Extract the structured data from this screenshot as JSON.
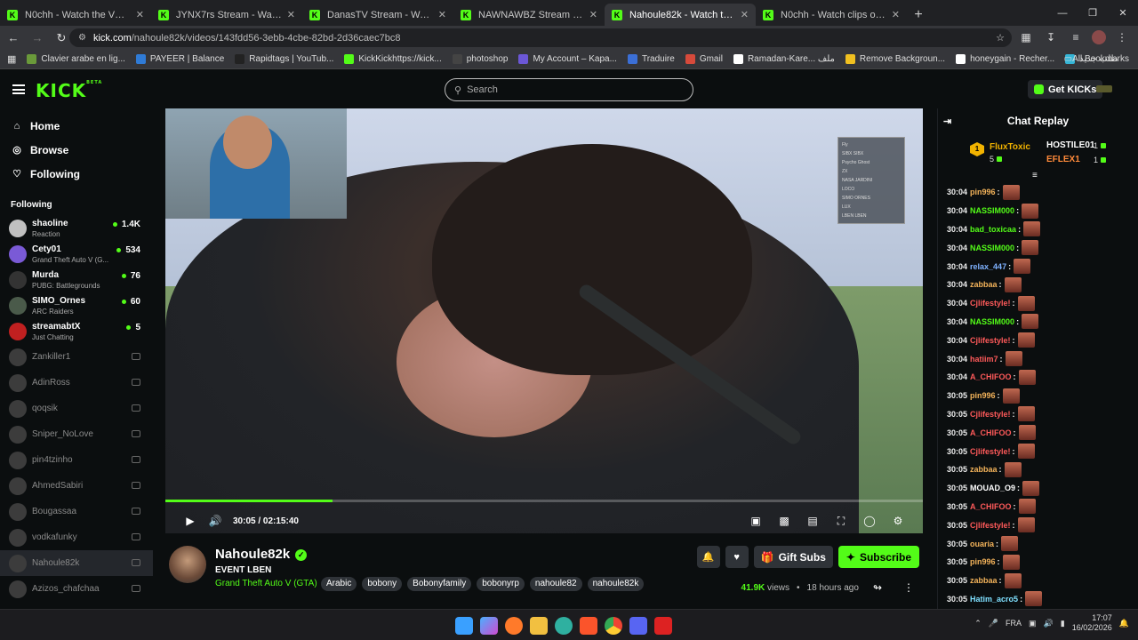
{
  "browser": {
    "tabs": [
      {
        "title": "N0chh - Watch the VOD on Kick",
        "active": false
      },
      {
        "title": "JYNX7rs Stream - Watch Live on Kick",
        "active": false
      },
      {
        "title": "DanasTV Stream - Watch Live on Kick",
        "active": false
      },
      {
        "title": "NAWNAWBZ Stream - Watch Live on Kick",
        "active": false
      },
      {
        "title": "Nahoule82k - Watch the VOD on Kick",
        "active": true
      },
      {
        "title": "N0chh - Watch clips on Kick",
        "active": false
      }
    ],
    "new_tab": "+",
    "url_domain": "kick.com",
    "url_path": "/nahoule82k/videos/143fdd56-3ebb-4cbe-82bd-2d36caec7bc8",
    "bookmarks": [
      {
        "label": "Clavier arabe en lig...",
        "color": "#6a9a3a"
      },
      {
        "label": "PAYEER | Balance",
        "color": "#2f7bd6"
      },
      {
        "label": "Rapidtags | YouTub...",
        "color": "#222222"
      },
      {
        "label": "KickKickhttps://kick...",
        "color": "#53fc18"
      },
      {
        "label": "photoshop",
        "color": "#444444"
      },
      {
        "label": "My Account – Kapa...",
        "color": "#6b57d6"
      },
      {
        "label": "Traduire",
        "color": "#3b6fd6"
      },
      {
        "label": "Gmail",
        "color": "#d64a3b"
      },
      {
        "label": "Ramadan-Kare... ملف",
        "color": "#ffffff"
      },
      {
        "label": "Remove Backgroun...",
        "color": "#f0c020"
      },
      {
        "label": "honeygain - Recher...",
        "color": "#ffffff"
      },
      {
        "label": "طلب جديد",
        "color": "#35b5d6"
      }
    ],
    "all_bookmarks": "All Bookmarks"
  },
  "header": {
    "logo": "KICK",
    "logo_badge": "BETA",
    "search_placeholder": "Search",
    "get_kicks": "Get KICKs"
  },
  "sidebar": {
    "nav": [
      {
        "label": "Home",
        "icon": "home-icon",
        "glyph": "⌂"
      },
      {
        "label": "Browse",
        "icon": "compass-icon",
        "glyph": "◎"
      },
      {
        "label": "Following",
        "icon": "heart-icon",
        "glyph": "♡"
      }
    ],
    "following_heading": "Following",
    "live": [
      {
        "name": "shaoline",
        "game": "Reaction",
        "viewers": "1.4K"
      },
      {
        "name": "Cety01",
        "game": "Grand Theft Auto V (G...",
        "viewers": "534"
      },
      {
        "name": "Murda",
        "game": "PUBG: Battlegrounds",
        "viewers": "76"
      },
      {
        "name": "SIMO_Ornes",
        "game": "ARC Raiders",
        "viewers": "60"
      },
      {
        "name": "streamabtX",
        "game": "Just Chatting",
        "viewers": "5"
      }
    ],
    "offline": [
      "Zankiller1",
      "AdinRoss",
      "qoqsik",
      "Sniper_NoLove",
      "pin4tzinho",
      "AhmedSabiri",
      "Bougassaa",
      "vodkafunky",
      "Nahoule82k",
      "Azizos_chafchaa"
    ]
  },
  "player": {
    "time": "30:05 / 02:15:40",
    "progress": 0.221,
    "overlay_list": [
      "Fly",
      "SIBX SIBX",
      "Psycho Ghost",
      "ZX",
      "NASA JARDINI",
      "LOCO",
      "SIMO ORNES",
      "LUX",
      "LBEN LBEN"
    ]
  },
  "stream_info": {
    "channel": "Nahoule82k",
    "title": "EVENT LBEN",
    "category": "Grand Theft Auto V (GTA)",
    "tags": [
      "Arabic",
      "bobony",
      "Bobonyfamily",
      "bobonyrp",
      "nahoule82",
      "nahoule82k"
    ],
    "gift_subs": "Gift Subs",
    "subscribe": "Subscribe",
    "views": "41.9K",
    "views_label": "views",
    "ago": "18 hours ago"
  },
  "chat": {
    "title": "Chat Replay",
    "leaderboard": {
      "first": {
        "rank": "1",
        "name": "FluxToxic",
        "count": "5"
      },
      "others": [
        {
          "name": "HOSTILE01",
          "count": "1"
        },
        {
          "name": "EFLEX1",
          "count": "1"
        }
      ]
    },
    "messages": [
      {
        "time": "30:04",
        "user": "pin996",
        "color": "#f2b25a"
      },
      {
        "time": "30:04",
        "user": "NASSIM000",
        "color": "#53fc18"
      },
      {
        "time": "30:04",
        "user": "bad_toxicaa",
        "color": "#53fc18"
      },
      {
        "time": "30:04",
        "user": "NASSIM000",
        "color": "#53fc18"
      },
      {
        "time": "30:04",
        "user": "relax_447",
        "color": "#7fb2ff"
      },
      {
        "time": "30:04",
        "user": "zabbaa",
        "color": "#f2b25a"
      },
      {
        "time": "30:04",
        "user": "Cjlifestyle!",
        "color": "#ff5a5a"
      },
      {
        "time": "30:04",
        "user": "NASSIM000",
        "color": "#53fc18"
      },
      {
        "time": "30:04",
        "user": "Cjlifestyle!",
        "color": "#ff5a5a"
      },
      {
        "time": "30:04",
        "user": "hatiim7",
        "color": "#ff5a5a"
      },
      {
        "time": "30:04",
        "user": "A_CHIFOO",
        "color": "#ff5a5a"
      },
      {
        "time": "30:05",
        "user": "pin996",
        "color": "#f2b25a"
      },
      {
        "time": "30:05",
        "user": "Cjlifestyle!",
        "color": "#ff5a5a"
      },
      {
        "time": "30:05",
        "user": "A_CHIFOO",
        "color": "#ff5a5a"
      },
      {
        "time": "30:05",
        "user": "Cjlifestyle!",
        "color": "#ff5a5a"
      },
      {
        "time": "30:05",
        "user": "zabbaa",
        "color": "#f2b25a"
      },
      {
        "time": "30:05",
        "user": "MOUAD_O9",
        "color": "#ffffff"
      },
      {
        "time": "30:05",
        "user": "A_CHIFOO",
        "color": "#ff5a5a"
      },
      {
        "time": "30:05",
        "user": "Cjlifestyle!",
        "color": "#ff5a5a"
      },
      {
        "time": "30:05",
        "user": "ouaria",
        "color": "#f2b25a"
      },
      {
        "time": "30:05",
        "user": "pin996",
        "color": "#f2b25a"
      },
      {
        "time": "30:05",
        "user": "zabbaa",
        "color": "#f2b25a"
      },
      {
        "time": "30:05",
        "user": "Hatim_acro5",
        "color": "#7fe0ff"
      }
    ]
  },
  "taskbar": {
    "lang": "FRA",
    "time": "17:07",
    "date": "16/02/2026"
  }
}
